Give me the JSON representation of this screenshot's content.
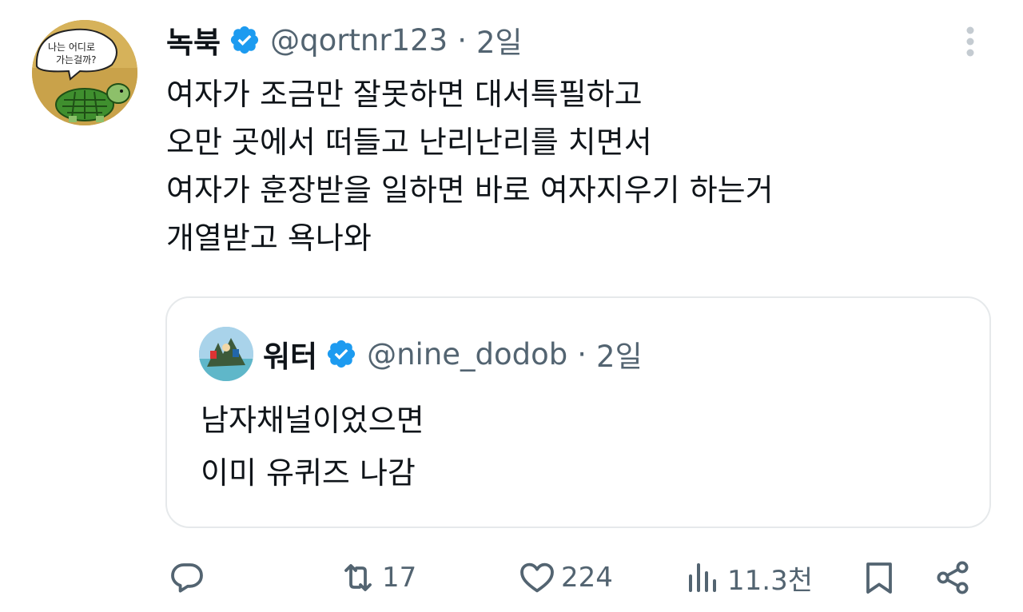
{
  "post": {
    "author": {
      "name": "녹북",
      "handle": "@qortnr123",
      "separator": "·",
      "time": "2일",
      "avatar_text_line1": "나는 어디로",
      "avatar_text_line2": "가는걸까?"
    },
    "text_lines": [
      "여자가 조금만 잘못하면 대서특필하고",
      "오만 곳에서 떠들고 난리난리를 치면서",
      "여자가 훈장받을 일하면 바로 여자지우기 하는거",
      "개열받고 욕나와"
    ]
  },
  "quote": {
    "author": {
      "name": "워터",
      "handle": "@nine_dodob",
      "separator": "·",
      "time": "2일"
    },
    "text_lines": [
      "남자채널이었으면",
      "이미 유퀴즈 나감"
    ]
  },
  "actions": {
    "reply": {
      "icon": "reply-icon",
      "count": ""
    },
    "retweet": {
      "icon": "retweet-icon",
      "count": "17"
    },
    "like": {
      "icon": "heart-icon",
      "count": "224"
    },
    "views": {
      "icon": "views-icon",
      "count": "11.3천"
    },
    "bookmark": {
      "icon": "bookmark-icon"
    },
    "share": {
      "icon": "share-icon"
    }
  },
  "colors": {
    "text_primary": "#0f1419",
    "text_secondary": "#536471",
    "verified": "#1d9bf0",
    "border": "#e6e9eb"
  }
}
